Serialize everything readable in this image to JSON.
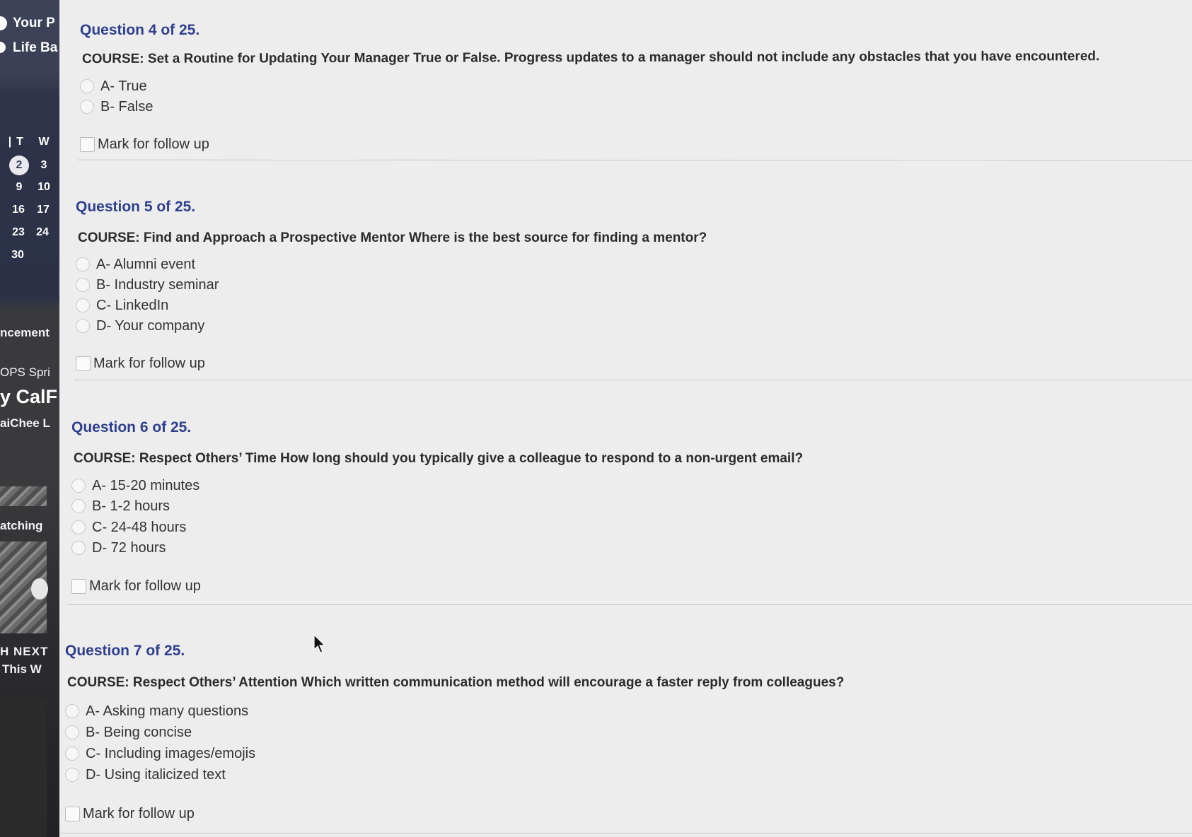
{
  "sidebar": {
    "nav": [
      "Your P",
      "Life Ba"
    ],
    "calendar": {
      "weekdays": [
        "T",
        "W"
      ],
      "rows": [
        [
          "2",
          "3"
        ],
        [
          "9",
          "10"
        ],
        [
          "16",
          "17"
        ],
        [
          "23",
          "24"
        ],
        [
          "30",
          ""
        ]
      ],
      "today": "2"
    },
    "items": [
      "ncement",
      "OPS Spri",
      "y CalF",
      "aiChee L",
      "atching",
      "H NEXT",
      "This W"
    ]
  },
  "questions": [
    {
      "title": "Question 4 of 25.",
      "text": "COURSE: Set a Routine for Updating Your Manager True or False. Progress updates to a manager should not include any obstacles that you have encountered.",
      "options": [
        "A- True",
        "B- False"
      ],
      "follow_up": "Mark for follow up"
    },
    {
      "title": "Question 5 of 25.",
      "text": "COURSE: Find and Approach a Prospective Mentor Where is the best source for finding a mentor?",
      "options": [
        "A- Alumni event",
        "B- Industry seminar",
        "C- LinkedIn",
        "D- Your company"
      ],
      "follow_up": "Mark for follow up"
    },
    {
      "title": "Question 6 of 25.",
      "text": "COURSE: Respect Others’ Time How long should you typically give a colleague to respond to a non-urgent email?",
      "options": [
        "A- 15-20 minutes",
        "B- 1-2 hours",
        "C- 24-48 hours",
        "D- 72 hours"
      ],
      "follow_up": "Mark for follow up"
    },
    {
      "title": "Question 7 of 25.",
      "text": "COURSE: Respect Others’ Attention Which written communication method will encourage a faster reply from colleagues?",
      "options": [
        "A- Asking many questions",
        "B- Being concise",
        "C- Including images/emojis",
        "D- Using italicized text"
      ],
      "follow_up": "Mark for follow up"
    }
  ],
  "colors": {
    "question_title": "#2f3f8f",
    "sidebar_bg": "#2c3147",
    "page_bg": "#ededee"
  },
  "icons": {
    "cursor": "mouse-pointer-icon",
    "radio": "radio-button-icon",
    "checkbox": "checkbox-icon"
  }
}
